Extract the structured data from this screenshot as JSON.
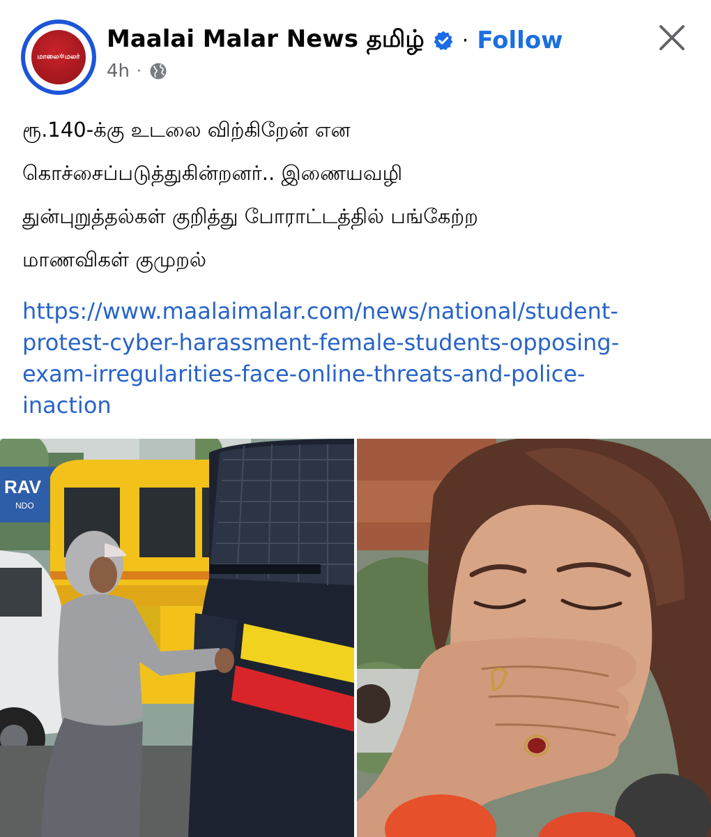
{
  "header": {
    "avatar_text": "மாலை✲மலர்",
    "page_name": "Maalai Malar News தமிழ்",
    "separator": "·",
    "follow_label": "Follow",
    "time": "4h",
    "meta_dot": "·",
    "icons": {
      "verified": "verified-badge-icon",
      "audience": "globe-icon",
      "close": "close-icon"
    }
  },
  "post": {
    "caption_lines": [
      "ரூ.140-க்கு உடலை விற்கிறேன் என",
      "கொச்சைப்படுத்துகின்றனர்.. இணையவழி",
      "துன்புறுத்தல்கள் குறித்து போராட்டத்தில் பங்கேற்ற",
      "மாணவிகள் குமுறல்"
    ],
    "link_lines": [
      "https://www.maalaimalar.com/news/national/student-",
      "protest-cyber-harassment-female-students-opposing-",
      "exam-irregularities-face-online-threats-and-police-",
      "inaction"
    ]
  },
  "images": {
    "left": {
      "description_label": "protest-photo",
      "bus_sign": "RAV",
      "bus_sign2": "NDO"
    },
    "right": {
      "description_label": "crying-student-photo"
    }
  },
  "colors": {
    "link": "#2763c9",
    "follow": "#1b6fe0",
    "verified": "#1d6be6",
    "avatar_ring": "#1d55d8",
    "logo_red": "#b51d24"
  }
}
